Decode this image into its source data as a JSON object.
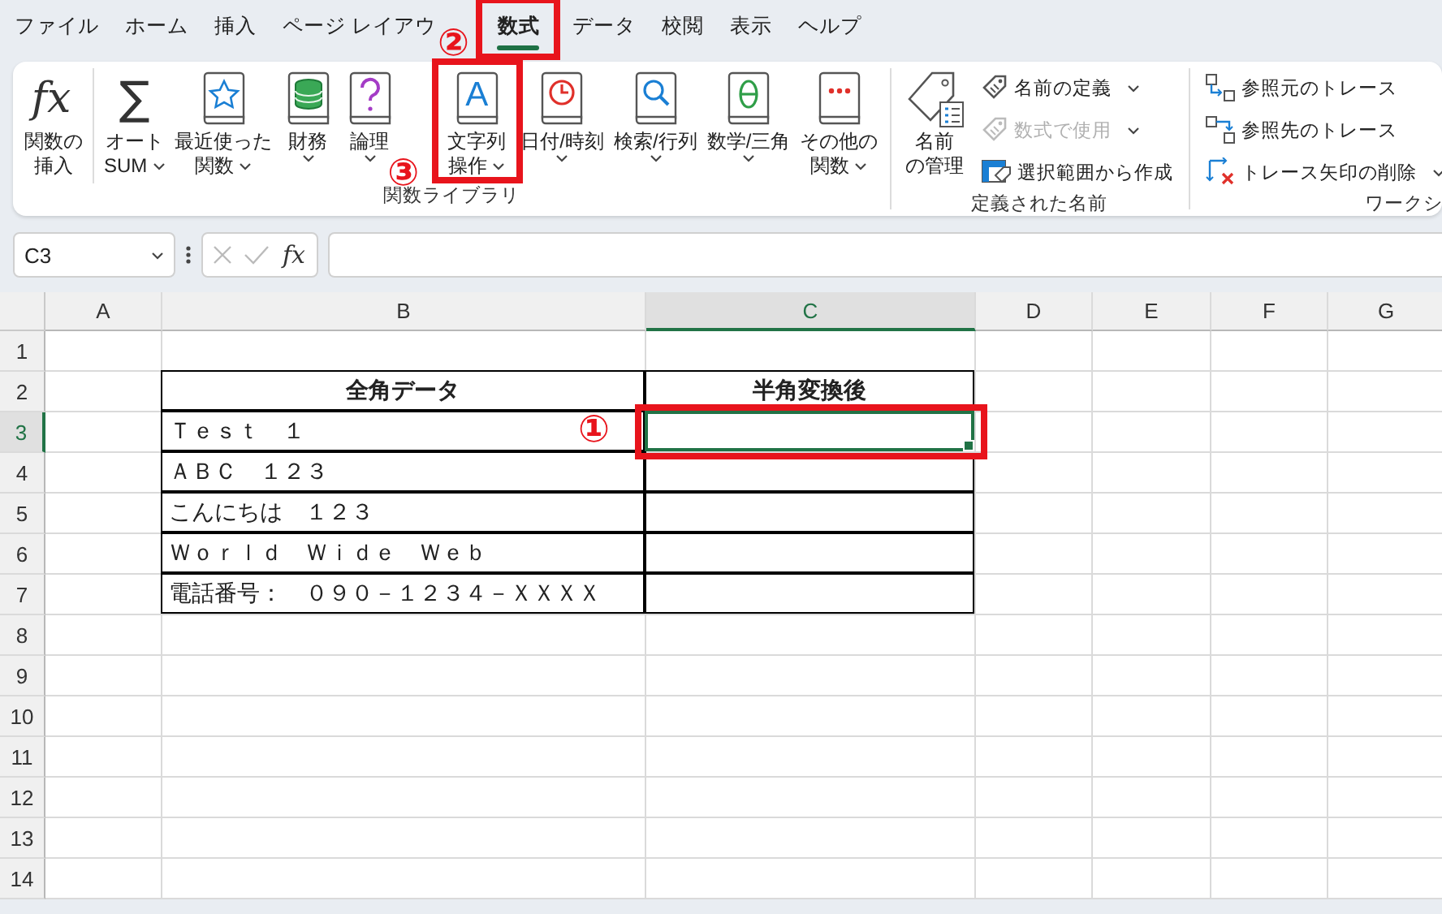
{
  "menu_tabs": [
    {
      "label": "ファイル",
      "selected": false
    },
    {
      "label": "ホーム",
      "selected": false
    },
    {
      "label": "挿入",
      "selected": false
    },
    {
      "label": "ページ レイアウ",
      "selected": false
    },
    {
      "label": "数式",
      "selected": true,
      "highlighted": true,
      "marker": "②"
    },
    {
      "label": "データ",
      "selected": false
    },
    {
      "label": "校閲",
      "selected": false
    },
    {
      "label": "表示",
      "selected": false
    },
    {
      "label": "ヘルプ",
      "selected": false
    }
  ],
  "ribbon": {
    "groups": [
      {
        "label": "関数ライブラリ",
        "items": [
          {
            "kind": "large",
            "glyph": "fx",
            "lines": [
              "関数の",
              "挿入"
            ],
            "dropdown": false
          },
          {
            "kind": "large",
            "glyph": "∑",
            "lines": [
              "オート",
              "SUM"
            ],
            "dropdown": true
          },
          {
            "kind": "large",
            "lines": [
              "最近使った",
              "関数"
            ],
            "dropdown": true
          },
          {
            "kind": "large",
            "lines": [
              "財務"
            ],
            "dropdown": true
          },
          {
            "kind": "large",
            "lines": [
              "論理"
            ],
            "dropdown": true
          },
          {
            "kind": "large",
            "glyph": "A",
            "lines": [
              "文字列",
              "操作"
            ],
            "dropdown": true,
            "highlighted": true,
            "marker": "③"
          },
          {
            "kind": "large",
            "lines": [
              "日付/時刻"
            ],
            "dropdown": true
          },
          {
            "kind": "large",
            "lines": [
              "検索/行列"
            ],
            "dropdown": true
          },
          {
            "kind": "large",
            "lines": [
              "数学/三角"
            ],
            "dropdown": true
          },
          {
            "kind": "large",
            "lines": [
              "その他の",
              "関数"
            ],
            "dropdown": true
          }
        ]
      },
      {
        "label": "定義された名前",
        "items": [
          {
            "kind": "large",
            "lines": [
              "名前",
              "の管理"
            ],
            "dropdown": false
          },
          {
            "kind": "small",
            "label": "名前の定義",
            "dropdown": true,
            "disabled": false
          },
          {
            "kind": "small",
            "label": "数式で使用",
            "dropdown": true,
            "disabled": true
          },
          {
            "kind": "small",
            "label": "選択範囲から作成",
            "dropdown": false,
            "disabled": false
          }
        ]
      },
      {
        "label": "ワークシ",
        "items": [
          {
            "kind": "small",
            "label": "参照元のトレース",
            "dropdown": false,
            "disabled": false
          },
          {
            "kind": "small",
            "label": "参照先のトレース",
            "dropdown": false,
            "disabled": false
          },
          {
            "kind": "small",
            "label": "トレース矢印の削除",
            "dropdown": true,
            "disabled": false
          }
        ]
      }
    ]
  },
  "formula_bar": {
    "name_box": "C3",
    "insert_function": "fx"
  },
  "sheet": {
    "columns": [
      {
        "label": "A",
        "selected": false
      },
      {
        "label": "B",
        "selected": false
      },
      {
        "label": "C",
        "selected": true
      },
      {
        "label": "D",
        "selected": false
      },
      {
        "label": "E",
        "selected": false
      },
      {
        "label": "F",
        "selected": false
      },
      {
        "label": "G",
        "selected": false
      }
    ],
    "rows": [
      {
        "label": "1",
        "selected": false
      },
      {
        "label": "2",
        "selected": false,
        "cells": [
          {
            "border": false,
            "selected": false
          },
          {
            "text": "全角データ",
            "bold": true,
            "border": true,
            "selected": false
          },
          {
            "text": "半角変換後",
            "bold": true,
            "border": true,
            "selected": false
          }
        ]
      },
      {
        "label": "3",
        "selected": true,
        "cells": [
          {
            "border": false,
            "selected": false
          },
          {
            "text": "Ｔｅｓｔ　１",
            "bold": false,
            "border": true,
            "selected": false
          },
          {
            "border": true,
            "selected": true,
            "highlighted": true,
            "marker": "①"
          }
        ]
      },
      {
        "label": "4",
        "selected": false,
        "cells": [
          {
            "border": false,
            "selected": false
          },
          {
            "text": "ＡＢＣ　１２３",
            "bold": false,
            "border": true,
            "selected": false
          },
          {
            "border": true,
            "selected": false
          }
        ]
      },
      {
        "label": "5",
        "selected": false,
        "cells": [
          {
            "border": false,
            "selected": false
          },
          {
            "text": "こんにちは　１２３",
            "bold": false,
            "border": true,
            "selected": false
          },
          {
            "border": true,
            "selected": false
          }
        ]
      },
      {
        "label": "6",
        "selected": false,
        "cells": [
          {
            "border": false,
            "selected": false
          },
          {
            "text": "Ｗｏｒｌｄ　Ｗｉｄｅ　Ｗｅｂ",
            "bold": false,
            "border": true,
            "selected": false
          },
          {
            "border": true,
            "selected": false
          }
        ]
      },
      {
        "label": "7",
        "selected": false,
        "cells": [
          {
            "border": false,
            "selected": false
          },
          {
            "text": "電話番号：　０９０－１２３４－ＸＸＸＸ",
            "bold": false,
            "border": true,
            "selected": false
          },
          {
            "border": true,
            "selected": false
          }
        ]
      },
      {
        "label": "8",
        "selected": false
      },
      {
        "label": "9",
        "selected": false
      },
      {
        "label": "10",
        "selected": false
      },
      {
        "label": "11",
        "selected": false
      },
      {
        "label": "12",
        "selected": false
      },
      {
        "label": "13",
        "selected": false
      },
      {
        "label": "14",
        "selected": false
      }
    ]
  }
}
